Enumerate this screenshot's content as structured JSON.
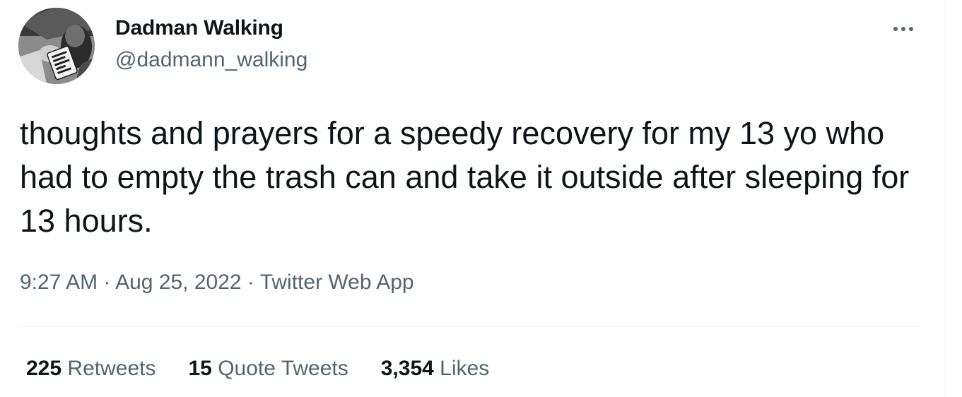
{
  "author": {
    "display_name": "Dadman Walking",
    "handle": "@dadmann_walking",
    "avatar_icon": "profile-photo-mug"
  },
  "more_icon": "ellipsis-icon",
  "tweet": {
    "text": "thoughts and prayers for a speedy recovery for my 13 yo who had to empty the trash can and take it outside after sleeping for 13 hours."
  },
  "meta": {
    "time": "9:27 AM",
    "sep1": " · ",
    "date": "Aug 25, 2022",
    "sep2": " · ",
    "source": "Twitter Web App"
  },
  "stats": {
    "retweets_count": "225",
    "retweets_label": "Retweets",
    "quotes_count": "15",
    "quotes_label": "Quote Tweets",
    "likes_count": "3,354",
    "likes_label": "Likes"
  },
  "colors": {
    "text_primary": "#0f1419",
    "text_secondary": "#536471",
    "divider": "#eff3f4"
  }
}
